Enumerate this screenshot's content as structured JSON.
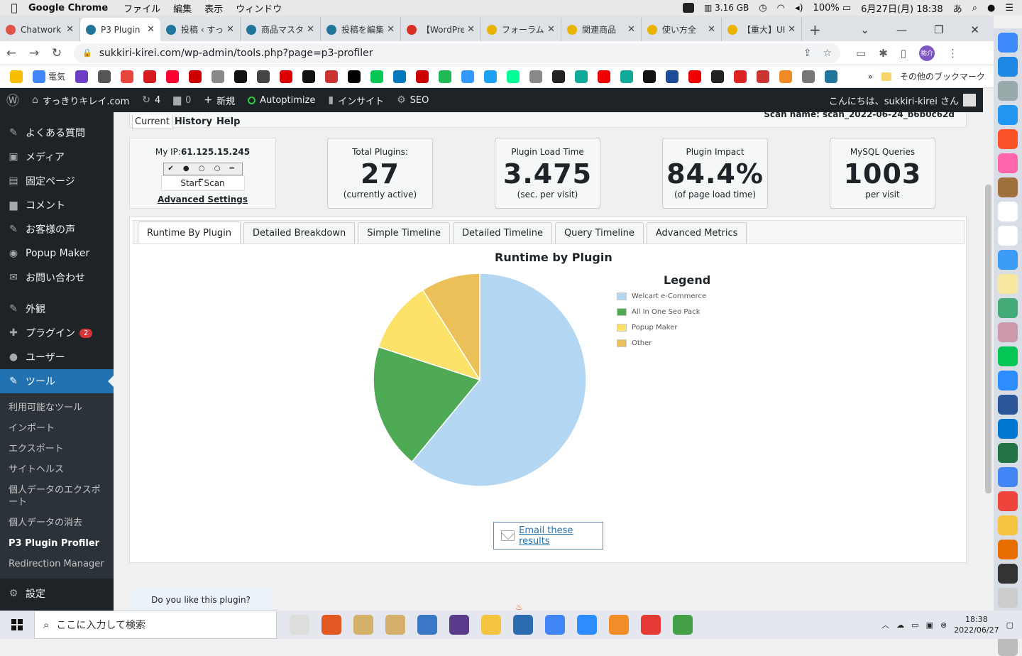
{
  "menubar": {
    "app_name": "Google Chrome",
    "menus": [
      "ファイル",
      "編集",
      "表示",
      "ウィンドウ"
    ],
    "memory": "3.16 GB",
    "battery": "100%",
    "datetime": "6月27日(月) 18:38",
    "input_mode": "あ"
  },
  "tabs": [
    {
      "title": "Chatwork",
      "color": "#e0524a"
    },
    {
      "title": "P3 Plugin",
      "color": "#21759b"
    },
    {
      "title": "投稿 ‹ すっ",
      "color": "#21759b"
    },
    {
      "title": "商品マスタ",
      "color": "#21759b"
    },
    {
      "title": "投稿を編集",
      "color": "#21759b"
    },
    {
      "title": "【WordPre",
      "color": "#d93025"
    },
    {
      "title": "フォーラム",
      "color": "#e8b400"
    },
    {
      "title": "関連商品",
      "color": "#e8b400"
    },
    {
      "title": "使い方全",
      "color": "#e8b400"
    },
    {
      "title": "【重大】UI",
      "color": "#e8b400"
    }
  ],
  "address": {
    "url": "sukkiri-kirei.com/wp-admin/tools.php?page=p3-profiler",
    "profile_initials": "祐介"
  },
  "bookmarks": {
    "labeled": "電気",
    "other": "その他のブックマーク"
  },
  "adminbar": {
    "site_name": "すっきりキレイ.com",
    "updates": "4",
    "comments": "0",
    "new": "新規",
    "autoptimize": "Autoptimize",
    "insight": "インサイト",
    "seo": "SEO",
    "howdy": "こんにちは、sukkiri-kirei さん"
  },
  "sidebar": {
    "items": [
      {
        "label": "よくある質問",
        "icon": "faq-icon"
      },
      {
        "label": "メディア",
        "icon": "media-icon"
      },
      {
        "label": "固定ページ",
        "icon": "page-icon"
      },
      {
        "label": "コメント",
        "icon": "comment-icon"
      },
      {
        "label": "お客様の声",
        "icon": "testimonial-icon"
      },
      {
        "label": "Popup Maker",
        "icon": "popup-icon"
      },
      {
        "label": "お問い合わせ",
        "icon": "mail-icon"
      },
      {
        "label": "外観",
        "icon": "appearance-icon"
      },
      {
        "label": "プラグイン",
        "icon": "plugin-icon",
        "badge": "2"
      },
      {
        "label": "ユーザー",
        "icon": "user-icon"
      },
      {
        "label": "ツール",
        "icon": "tool-icon"
      }
    ],
    "submenu": [
      "利用可能なツール",
      "インポート",
      "エクスポート",
      "サイトヘルス",
      "個人データのエクスポート",
      "個人データの消去",
      "P3 Plugin Profiler",
      "Redirection Manager"
    ],
    "settings": "設定"
  },
  "profiler": {
    "scan_tabs": {
      "current": "Current",
      "history": "History",
      "help": "Help"
    },
    "scan_name": "Scan name: scan_2022-06-24_b6b0c62d",
    "ip_label": "My IP:",
    "ip": "61.125.15.245",
    "progress": "✔ ● ○ ○ ━ ━",
    "start_scan": "Start Scan",
    "advanced_settings": "Advanced Settings",
    "stats": [
      {
        "label": "Total Plugins:",
        "value": "27",
        "sub": "(currently active)"
      },
      {
        "label": "Plugin Load Time",
        "value": "3.475",
        "sub": "(sec. per visit)"
      },
      {
        "label": "Plugin Impact",
        "value": "84.4%",
        "sub": "(of page load time)"
      },
      {
        "label": "MySQL Queries",
        "value": "1003",
        "sub": "per visit"
      }
    ],
    "panel_tabs": [
      "Runtime By Plugin",
      "Detailed Breakdown",
      "Simple Timeline",
      "Detailed Timeline",
      "Query Timeline",
      "Advanced Metrics"
    ],
    "email_results": "Email these results",
    "like_prompt": "Do you like this plugin?"
  },
  "chart_data": {
    "type": "pie",
    "title": "Runtime by Plugin",
    "legend_title": "Legend",
    "legend_position": "right",
    "series": [
      {
        "name": "Welcart e-Commerce",
        "value": 61,
        "color": "#b3d7f2"
      },
      {
        "name": "All In One Seo Pack",
        "value": 19,
        "color": "#4faa55"
      },
      {
        "name": "Popup Maker",
        "value": 11,
        "color": "#fde26a"
      },
      {
        "name": "Other",
        "value": 9,
        "color": "#ecc058"
      }
    ]
  },
  "taskbar": {
    "search_placeholder": "ここに入力して検索",
    "time": "18:38",
    "date": "2022/06/27"
  }
}
